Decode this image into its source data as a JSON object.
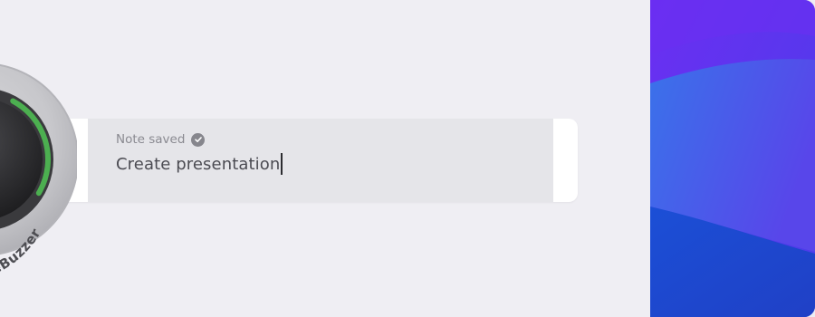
{
  "dial": {
    "brand_text": "TimeBuzzer",
    "accent": "#4caf50"
  },
  "note": {
    "status_label": "Note saved",
    "status_icon": "check-circle-icon",
    "text": "Create presentation"
  },
  "colors": {
    "background": "#efeef3",
    "field": "#e5e5e9",
    "wallpaper_top": "#6a37f0",
    "wallpaper_mid": "#3a62e8",
    "wallpaper_bottom": "#1d49d0"
  }
}
